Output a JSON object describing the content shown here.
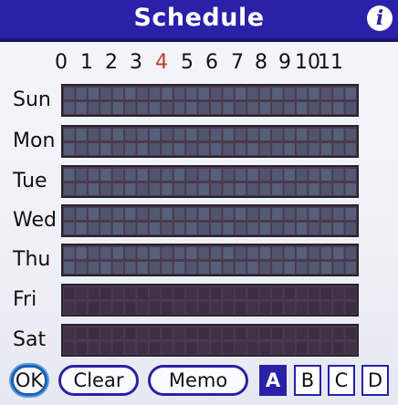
{
  "title": "Schedule",
  "info_icon": "info-icon",
  "hours": [
    "0",
    "1",
    "2",
    "3",
    "4",
    "5",
    "6",
    "7",
    "8",
    "9",
    "10",
    "11"
  ],
  "current_hour_index": 4,
  "days": [
    "Sun",
    "Mon",
    "Tue",
    "Wed",
    "Thu",
    "Fri",
    "Sat"
  ],
  "buttons": {
    "ok": "OK",
    "clear": "Clear",
    "memo": "Memo"
  },
  "pages": [
    "A",
    "B",
    "C",
    "D"
  ],
  "active_page": "A",
  "colors": {
    "title_bar": "#2b20a8",
    "accent": "#2b20a8",
    "current_hour": "#c0392b",
    "cell": "#5a6a86",
    "cell_dark": "#3a2a3e"
  }
}
